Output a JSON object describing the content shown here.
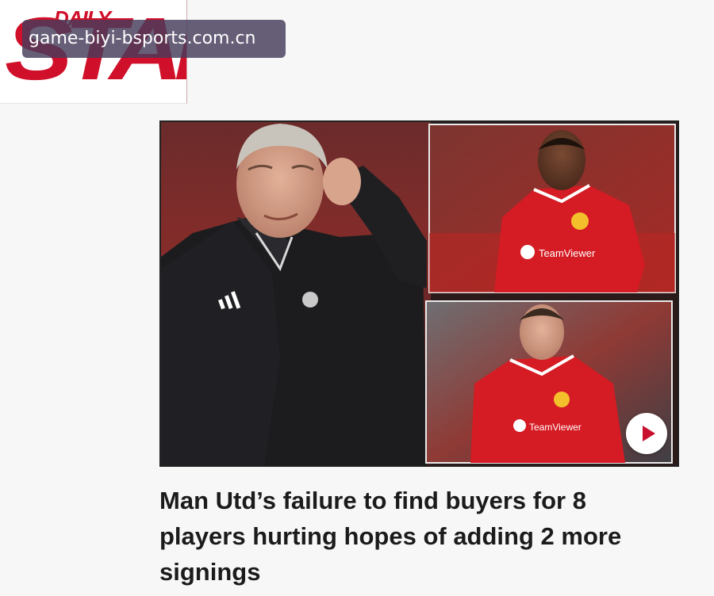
{
  "brand": {
    "daily": "DAILY",
    "star": "STAR"
  },
  "watermark": "game-biyi-bsports.com.cn",
  "hero": {
    "sponsor_top": "TeamViewer",
    "sponsor_bottom": "TeamViewer",
    "play_icon": "play-icon"
  },
  "headline": "Man Utd’s failure to find buyers for 8 players hurting hopes of adding 2 more signings",
  "colors": {
    "brand_red": "#d0102a",
    "kit_red": "#d51b23",
    "jacket": "#1c1c1e"
  }
}
